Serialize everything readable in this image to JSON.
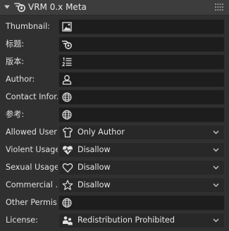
{
  "panel": {
    "title": "VRM 0.x Meta",
    "header_icon": "vrm-logo-icon"
  },
  "fields": {
    "thumbnail": {
      "label": "Thumbnail:",
      "icon": "image-icon"
    },
    "title": {
      "label": "标题:",
      "icon": "blender-logo-icon"
    },
    "version": {
      "label": "版本:",
      "icon": "numbered-list-icon"
    },
    "author": {
      "label": "Author:",
      "icon": "person-icon"
    },
    "contact_info": {
      "label": "Contact Infor...",
      "icon": "globe-icon"
    },
    "reference": {
      "label": "参考:",
      "icon": "globe-icon"
    },
    "allowed_user": {
      "label": "Allowed User:",
      "value": "Only Author",
      "icon": "shirt-icon"
    },
    "violent_usage": {
      "label": "Violent Usage:",
      "value": "Disallow",
      "icon": "heart-pulse-icon"
    },
    "sexual_usage": {
      "label": "Sexual Usage:",
      "value": "Disallow",
      "icon": "heart-icon"
    },
    "commercial_usage": {
      "label": "Commercial ...",
      "value": "Disallow",
      "icon": "star-icon"
    },
    "other_permission": {
      "label": "Other Permis...",
      "icon": "globe-icon"
    },
    "license": {
      "label": "License:",
      "value": "Redistribution Prohibited",
      "icon": "group-icon"
    }
  }
}
